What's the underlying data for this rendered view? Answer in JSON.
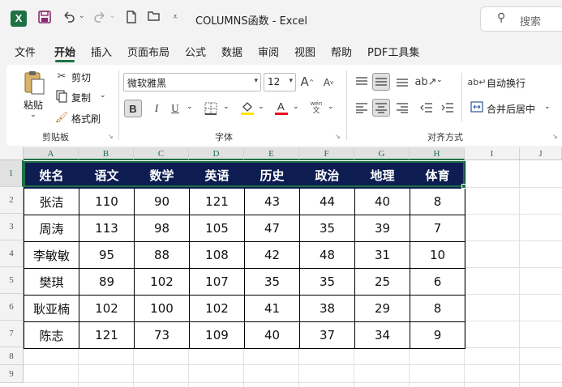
{
  "titlebar": {
    "doc_title": "COLUMNS函数  -  Excel",
    "search_placeholder": "搜索"
  },
  "menu": {
    "items": [
      "文件",
      "开始",
      "插入",
      "页面布局",
      "公式",
      "数据",
      "审阅",
      "视图",
      "帮助",
      "PDF工具集"
    ],
    "active_index": 1
  },
  "ribbon": {
    "clipboard": {
      "paste": "粘贴",
      "cut": "剪切",
      "copy": "复制",
      "format_painter": "格式刷",
      "label": "剪贴板"
    },
    "font": {
      "name": "微软雅黑",
      "size": "12",
      "label": "字体",
      "bold": "B",
      "italic": "I",
      "underline": "U"
    },
    "alignment": {
      "wrap": "自动换行",
      "merge": "合并后居中",
      "label": "对齐方式"
    }
  },
  "sheet": {
    "columns": [
      "A",
      "B",
      "C",
      "D",
      "E",
      "F",
      "G",
      "H",
      "I",
      "J"
    ],
    "rows": [
      "1",
      "2",
      "3",
      "4",
      "5",
      "6",
      "7",
      "8",
      "9"
    ],
    "headers": [
      "姓名",
      "语文",
      "数学",
      "英语",
      "历史",
      "政治",
      "地理",
      "体育"
    ],
    "data": [
      [
        "张洁",
        "110",
        "90",
        "121",
        "43",
        "44",
        "40",
        "8"
      ],
      [
        "周涛",
        "113",
        "98",
        "105",
        "47",
        "35",
        "39",
        "7"
      ],
      [
        "李敏敏",
        "95",
        "88",
        "108",
        "42",
        "48",
        "31",
        "10"
      ],
      [
        "樊琪",
        "89",
        "102",
        "107",
        "35",
        "35",
        "25",
        "6"
      ],
      [
        "耿亚楠",
        "102",
        "100",
        "102",
        "41",
        "38",
        "29",
        "8"
      ],
      [
        "陈志",
        "121",
        "73",
        "109",
        "40",
        "37",
        "34",
        "9"
      ]
    ]
  },
  "colors": {
    "excel_green": "#1e7145",
    "header_fill": "#0d1d52"
  }
}
